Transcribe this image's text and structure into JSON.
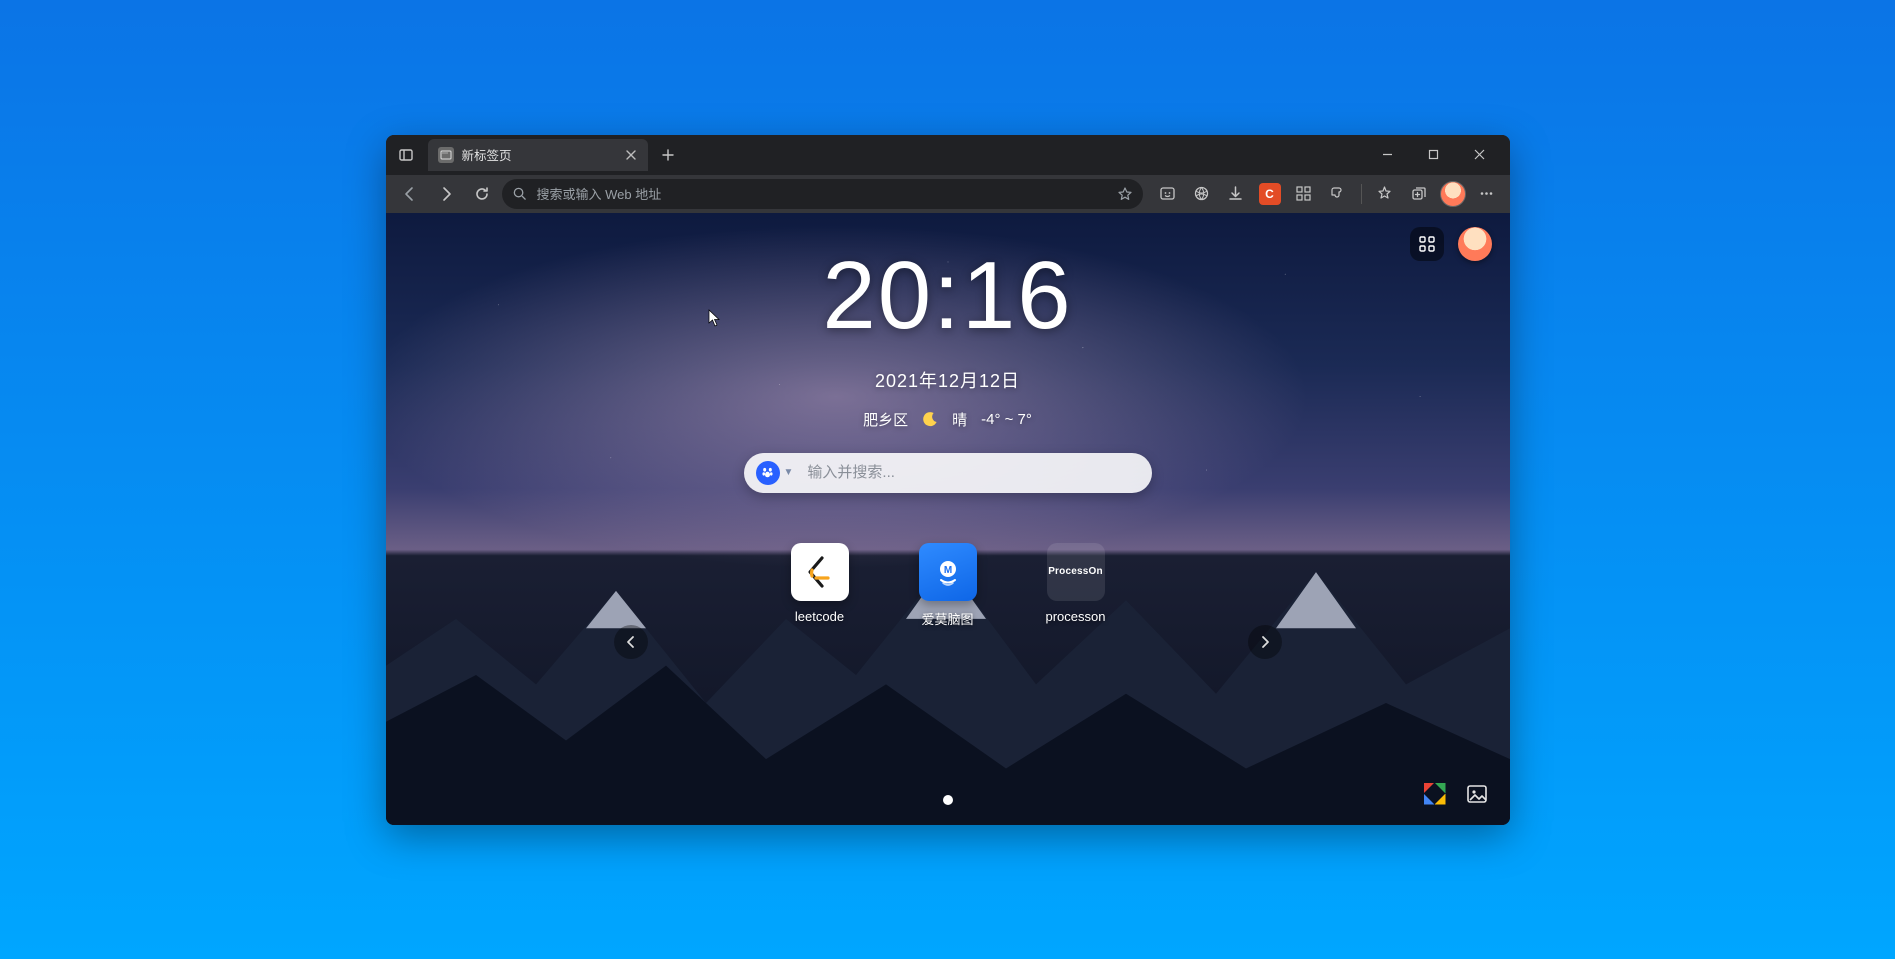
{
  "tab": {
    "title": "新标签页"
  },
  "address": {
    "placeholder": "搜索或输入 Web 地址"
  },
  "extensions": {
    "badge_letter": "C"
  },
  "newtab": {
    "time": "20:16",
    "date": "2021年12月12日",
    "weather": {
      "location": "肥乡区",
      "condition": "晴",
      "temp_range": "-4° ~ 7°"
    },
    "search_placeholder": "输入并搜索...",
    "shortcuts": [
      {
        "label": "leetcode"
      },
      {
        "label": "爱莫脑图"
      },
      {
        "label": "processon"
      }
    ],
    "processon_tile_text": "ProcessOn"
  }
}
